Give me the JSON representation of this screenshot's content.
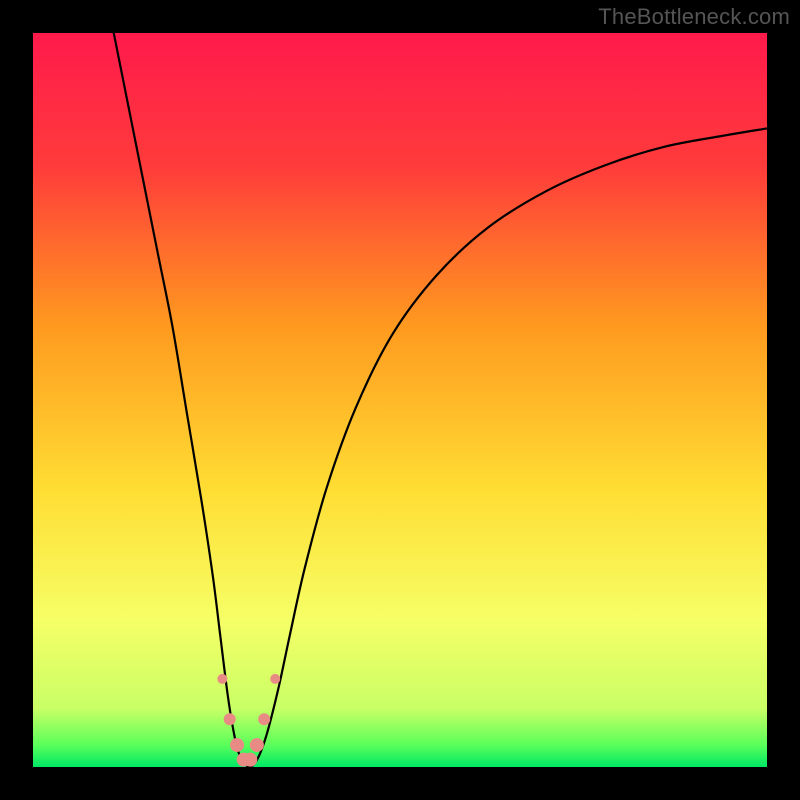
{
  "watermark": "TheBottleneck.com",
  "chart_data": {
    "type": "line",
    "title": "",
    "xlabel": "",
    "ylabel": "",
    "xlim": [
      0,
      100
    ],
    "ylim": [
      0,
      100
    ],
    "gradient_stops": [
      {
        "offset": 0,
        "color": "#ff1a4c"
      },
      {
        "offset": 0.18,
        "color": "#ff3b3b"
      },
      {
        "offset": 0.4,
        "color": "#ff9a1f"
      },
      {
        "offset": 0.62,
        "color": "#ffdd33"
      },
      {
        "offset": 0.8,
        "color": "#f6ff66"
      },
      {
        "offset": 0.92,
        "color": "#c9ff66"
      },
      {
        "offset": 0.97,
        "color": "#5aff5a"
      },
      {
        "offset": 1.0,
        "color": "#00e866"
      }
    ],
    "series": [
      {
        "name": "bottleneck-curve",
        "x": [
          11.0,
          13.0,
          15.0,
          17.0,
          19.0,
          21.0,
          23.0,
          24.5,
          25.5,
          26.5,
          27.3,
          28.0,
          28.8,
          29.5,
          30.2,
          31.0,
          32.0,
          33.5,
          35.0,
          37.0,
          40.0,
          44.0,
          49.0,
          55.0,
          62.0,
          70.0,
          78.0,
          86.0,
          94.0,
          100.0
        ],
        "y": [
          100.0,
          90.0,
          80.0,
          70.0,
          60.0,
          48.0,
          36.0,
          26.0,
          18.0,
          10.0,
          5.0,
          2.0,
          0.5,
          0.0,
          0.5,
          2.0,
          5.0,
          11.0,
          18.0,
          27.0,
          38.0,
          49.0,
          59.0,
          67.0,
          73.5,
          78.5,
          82.0,
          84.5,
          86.0,
          87.0
        ]
      }
    ],
    "markers": {
      "name": "highlighted-points",
      "color": "#e98b85",
      "points": [
        {
          "x": 25.8,
          "y": 12.0,
          "r": 5
        },
        {
          "x": 26.8,
          "y": 6.5,
          "r": 6
        },
        {
          "x": 27.8,
          "y": 3.0,
          "r": 7
        },
        {
          "x": 28.7,
          "y": 1.0,
          "r": 7
        },
        {
          "x": 29.6,
          "y": 1.0,
          "r": 7
        },
        {
          "x": 30.5,
          "y": 3.0,
          "r": 7
        },
        {
          "x": 31.5,
          "y": 6.5,
          "r": 6
        },
        {
          "x": 33.0,
          "y": 12.0,
          "r": 5
        }
      ]
    }
  }
}
